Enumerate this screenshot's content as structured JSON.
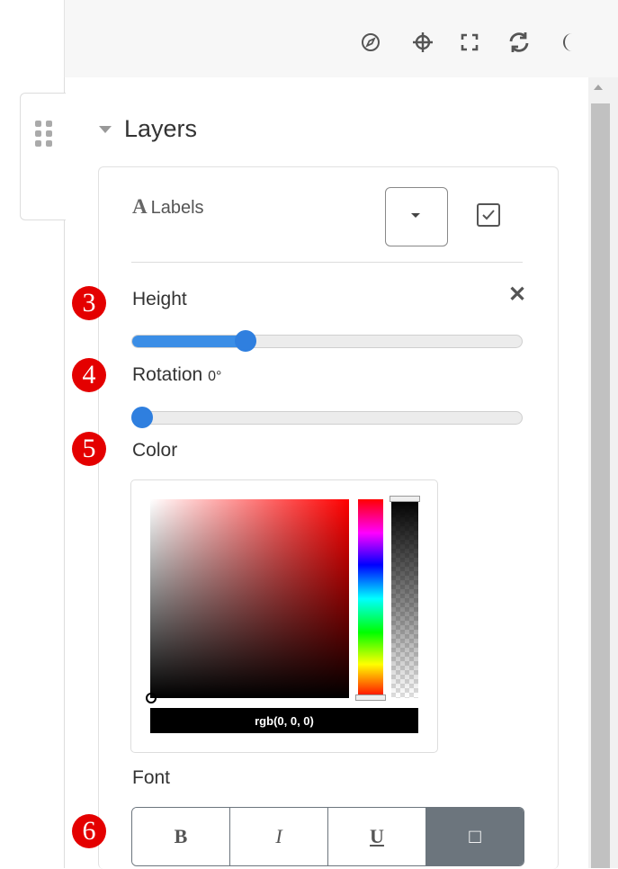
{
  "toolbar": {
    "icons": [
      "compass-icon",
      "crosshair-icon",
      "fullscreen-icon",
      "refresh-icon",
      "moon-icon"
    ]
  },
  "layers": {
    "title": "Layers",
    "labels_title": "Labels",
    "labels_icon_glyph": "A",
    "visible_checked": true
  },
  "fields": {
    "height": {
      "label": "Height",
      "badge": "3",
      "value_fraction": 0.28
    },
    "rotation": {
      "label": "Rotation",
      "value_text": "0°",
      "badge": "4",
      "value_fraction": 0.0
    },
    "color": {
      "label": "Color",
      "badge": "5",
      "value": "rgb(0, 0, 0)"
    }
  },
  "font": {
    "label": "Font",
    "badge": "6",
    "buttons": [
      {
        "glyph": "B",
        "name": "bold",
        "active": false
      },
      {
        "glyph": "I",
        "name": "italic",
        "active": false
      },
      {
        "glyph": "U",
        "name": "underline",
        "active": false
      },
      {
        "glyph": "□",
        "name": "background",
        "active": true
      }
    ]
  },
  "colors": {
    "accent": "#2f7fdf",
    "badge": "#e40000",
    "active_button": "#6c757d"
  }
}
